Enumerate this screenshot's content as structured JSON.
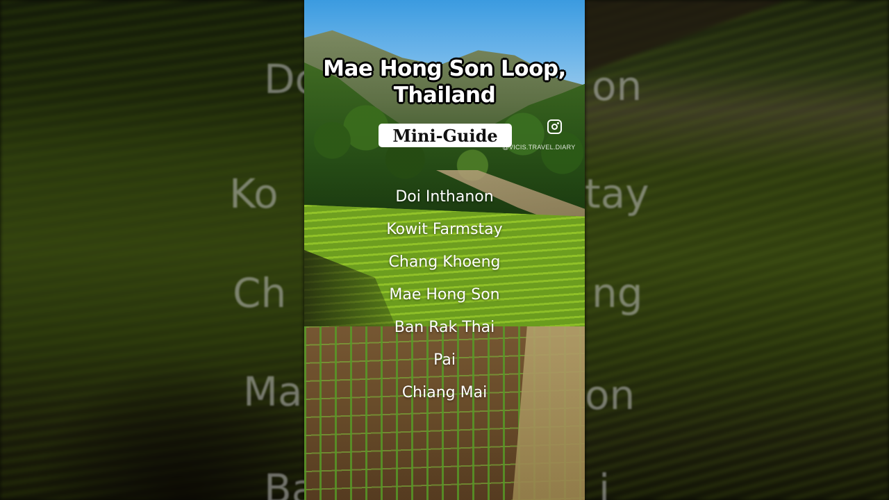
{
  "video": {
    "title_lines": [
      "Mae Hong Son Loop,",
      "Thailand"
    ],
    "badge_label": "Mini-Guide",
    "handle": "@VICIS.TRAVEL.DIARY",
    "social_icon": "instagram-icon",
    "stops": [
      "Doi Inthanon",
      "Kowit Farmstay",
      "Chang Khoeng",
      "Mae Hong Son",
      "Ban Rak Thai",
      "Pai",
      "Chiang Mai"
    ]
  },
  "backdrop": {
    "left_ghost_words": [
      "Do",
      "Ko",
      "Ch",
      "Ma",
      "Ba"
    ],
    "right_ghost_words": [
      "on",
      "tay",
      "ng",
      "on",
      "i"
    ]
  },
  "colors": {
    "title_text": "#ffffff",
    "title_outline": "#000000",
    "badge_bg": "#ffffff",
    "badge_text": "#111111",
    "stop_text": "#ffffff"
  }
}
